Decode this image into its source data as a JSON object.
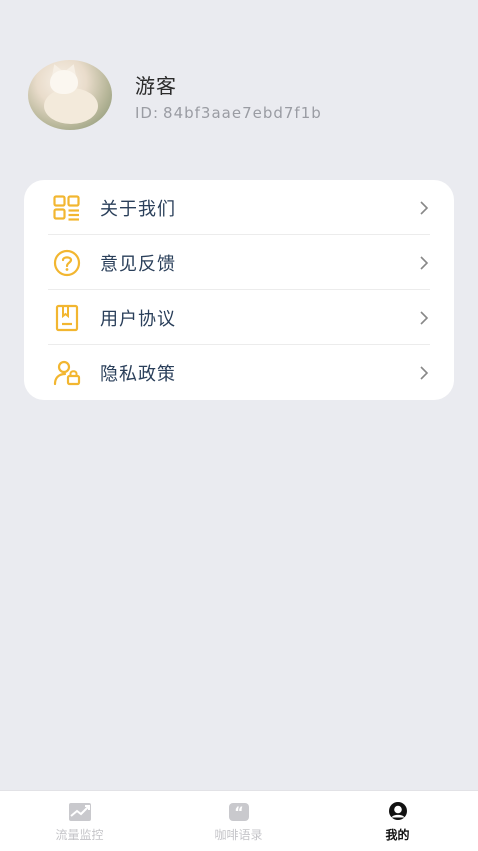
{
  "profile": {
    "name": "游客",
    "id_label": "ID:",
    "id_value": "84bf3aae7ebd7f1b"
  },
  "menu": {
    "items": [
      {
        "label": "关于我们",
        "icon": "qr-grid-icon"
      },
      {
        "label": "意见反馈",
        "icon": "question-circle-icon"
      },
      {
        "label": "用户协议",
        "icon": "document-icon"
      },
      {
        "label": "隐私政策",
        "icon": "user-lock-icon"
      }
    ]
  },
  "tabbar": {
    "tabs": [
      {
        "label": "流量监控",
        "icon": "trend-chart-icon",
        "active": false
      },
      {
        "label": "咖啡语录",
        "icon": "quote-icon",
        "active": false
      },
      {
        "label": "我的",
        "icon": "user-icon",
        "active": true
      }
    ]
  },
  "colors": {
    "background": "#eaebf0",
    "card": "#ffffff",
    "icon_accent": "#f2b630",
    "menu_text": "#2a3f5a",
    "tab_inactive": "#c4c4c8",
    "tab_active": "#111111"
  }
}
